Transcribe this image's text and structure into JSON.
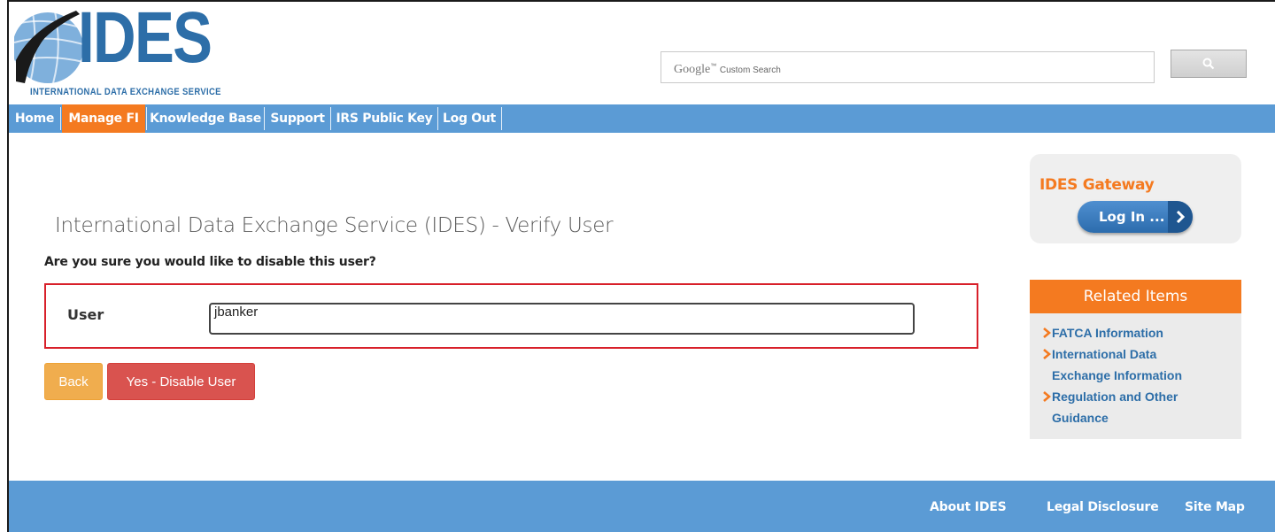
{
  "logo": {
    "word": "IDES",
    "subtitle": "INTERNATIONAL DATA EXCHANGE SERVICE"
  },
  "search": {
    "placeholder_brand": "Google",
    "placeholder_tm": "™",
    "placeholder_text": "Custom Search",
    "button_icon": "search-icon"
  },
  "nav": {
    "items": [
      {
        "label": "Home"
      },
      {
        "label": "Manage FI",
        "active": true
      },
      {
        "label": "Knowledge Base"
      },
      {
        "label": "Support"
      },
      {
        "label": "IRS Public Key"
      },
      {
        "label": "Log Out"
      }
    ]
  },
  "main": {
    "title": "International Data Exchange Service (IDES) - Verify User",
    "question": "Are you sure you would like to disable this user?",
    "user_label": "User",
    "user_value": "jbanker",
    "back_label": "Back",
    "disable_label": "Yes - Disable User"
  },
  "sidebar": {
    "gateway_title": "IDES Gateway",
    "login_label": "Log In ...",
    "related_title": "Related Items",
    "related_links": [
      {
        "line1": "FATCA Information"
      },
      {
        "line1": "International Data",
        "line2": "Exchange Information"
      },
      {
        "line1": "Regulation and Other",
        "line2": "Guidance"
      }
    ]
  },
  "footer": {
    "links": [
      "About IDES",
      "Legal Disclosure",
      "Site Map"
    ]
  },
  "colors": {
    "brand_blue": "#2d6ea8",
    "nav_blue": "#5b9bd5",
    "accent_orange": "#f47a20",
    "danger_red": "#d9534f",
    "warning_orange": "#f0ad4e"
  }
}
